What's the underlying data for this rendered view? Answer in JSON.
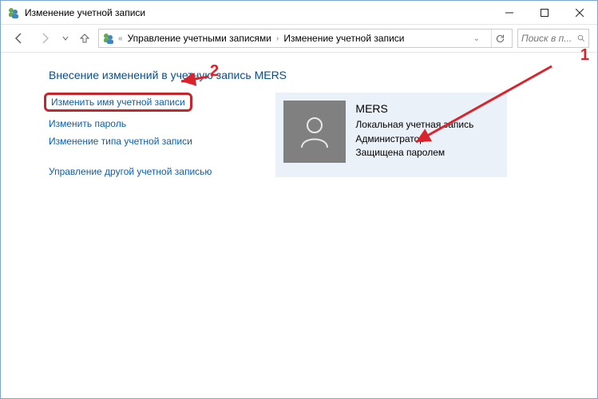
{
  "window": {
    "title": "Изменение учетной записи"
  },
  "breadcrumb": {
    "seg1": "Управление учетными записями",
    "seg2": "Изменение учетной записи"
  },
  "search": {
    "placeholder": "Поиск в п..."
  },
  "heading": "Внесение изменений в учетную запись MERS",
  "links": {
    "rename": "Изменить имя учетной записи",
    "password": "Изменить пароль",
    "type": "Изменение типа учетной записи",
    "other": "Управление другой учетной записью"
  },
  "account": {
    "name": "MERS",
    "line1": "Локальная учетная запись",
    "line2": "Администратор",
    "line3": "Защищена паролем"
  },
  "annotations": {
    "one": "1",
    "two": "2"
  }
}
